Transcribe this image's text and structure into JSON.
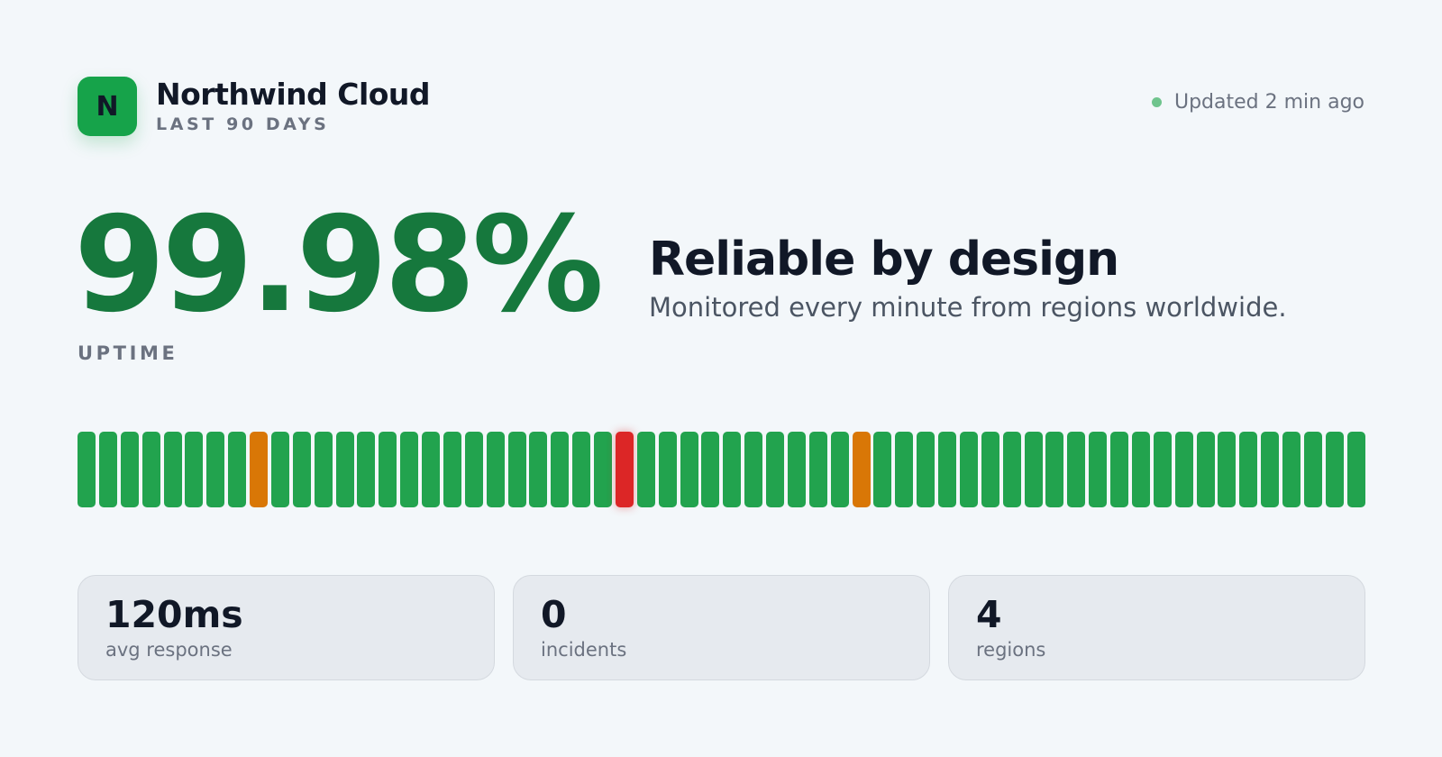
{
  "brand": {
    "logo_letter": "N",
    "name": "Northwind Cloud",
    "period": "LAST 90 DAYS"
  },
  "status": {
    "updated_text": "Updated 2 min ago",
    "dot_color": "#6fc48d"
  },
  "uptime": {
    "value": "99.98%",
    "label": "UPTIME",
    "color": "#16783d"
  },
  "tagline": {
    "title": "Reliable by design",
    "subtitle": "Monitored every minute from regions worldwide."
  },
  "history": {
    "bar_count": 60,
    "default_status": "operational",
    "exceptions": [
      {
        "index": 8,
        "status": "degraded"
      },
      {
        "index": 25,
        "status": "outage"
      },
      {
        "index": 36,
        "status": "degraded"
      }
    ],
    "colors": {
      "operational": "#22a34e",
      "degraded": "#d97706",
      "outage": "#dc2626"
    }
  },
  "stats": [
    {
      "value": "120ms",
      "label": "avg response"
    },
    {
      "value": "0",
      "label": "incidents"
    },
    {
      "value": "4",
      "label": "regions"
    }
  ]
}
